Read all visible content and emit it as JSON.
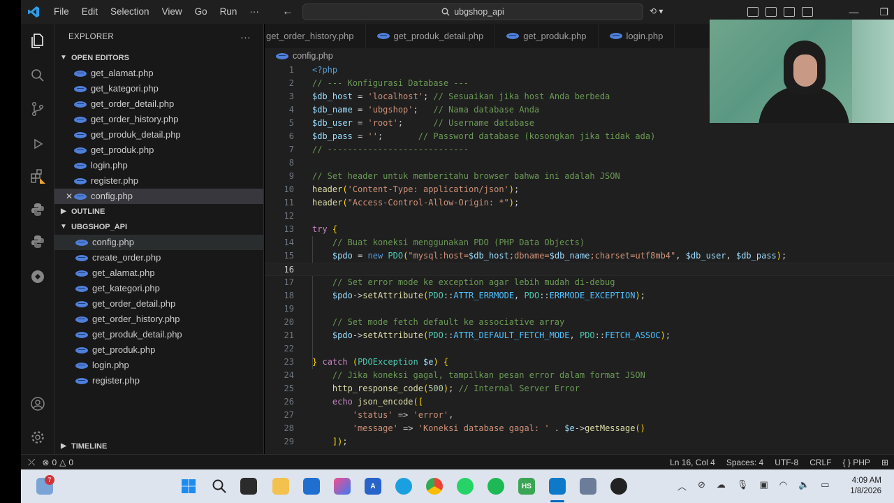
{
  "titlebar": {
    "menu": [
      "File",
      "Edit",
      "Selection",
      "View",
      "Go",
      "Run",
      "···"
    ],
    "search_text": "ubgshop_api"
  },
  "sidebar": {
    "title": "EXPLORER",
    "open_editors_label": "OPEN EDITORS",
    "open_editors": [
      "get_alamat.php",
      "get_kategori.php",
      "get_order_detail.php",
      "get_order_history.php",
      "get_produk_detail.php",
      "get_produk.php",
      "login.php",
      "register.php",
      "config.php"
    ],
    "outline_label": "OUTLINE",
    "project_label": "UBGSHOP_API",
    "project_files": [
      "config.php",
      "create_order.php",
      "get_alamat.php",
      "get_kategori.php",
      "get_order_detail.php",
      "get_order_history.php",
      "get_produk_detail.php",
      "get_produk.php",
      "login.php",
      "register.php"
    ],
    "timeline_label": "TIMELINE"
  },
  "tabs": [
    "get_order_history.php",
    "get_produk_detail.php",
    "get_produk.php",
    "login.php"
  ],
  "breadcrumb": "config.php",
  "editor": {
    "current_line": 16,
    "lines": [
      {
        "n": "1",
        "text": "<?php"
      },
      {
        "n": "2",
        "text": "// --- Konfigurasi Database ---"
      },
      {
        "n": "3",
        "text": "$db_host = 'localhost'; // Sesuaikan jika host Anda berbeda"
      },
      {
        "n": "4",
        "text": "$db_name = 'ubgshop';   // Nama database Anda"
      },
      {
        "n": "5",
        "text": "$db_user = 'root';      // Username database"
      },
      {
        "n": "6",
        "text": "$db_pass = '';       // Password database (kosongkan jika tidak ada)"
      },
      {
        "n": "7",
        "text": "// ----------------------------"
      },
      {
        "n": "8",
        "text": ""
      },
      {
        "n": "9",
        "text": "// Set header untuk memberitahu browser bahwa ini adalah JSON"
      },
      {
        "n": "10",
        "text": "header('Content-Type: application/json');"
      },
      {
        "n": "11",
        "text": "header(\"Access-Control-Allow-Origin: *\");"
      },
      {
        "n": "12",
        "text": ""
      },
      {
        "n": "13",
        "text": "try {"
      },
      {
        "n": "14",
        "text": "    // Buat koneksi menggunakan PDO (PHP Data Objects)"
      },
      {
        "n": "15",
        "text": "    $pdo = new PDO(\"mysql:host=$db_host;dbname=$db_name;charset=utf8mb4\", $db_user, $db_pass);"
      },
      {
        "n": "16",
        "text": ""
      },
      {
        "n": "17",
        "text": "    // Set error mode ke exception agar lebih mudah di-debug"
      },
      {
        "n": "18",
        "text": "    $pdo->setAttribute(PDO::ATTR_ERRMODE, PDO::ERRMODE_EXCEPTION);"
      },
      {
        "n": "19",
        "text": ""
      },
      {
        "n": "20",
        "text": "    // Set mode fetch default ke associative array"
      },
      {
        "n": "21",
        "text": "    $pdo->setAttribute(PDO::ATTR_DEFAULT_FETCH_MODE, PDO::FETCH_ASSOC);"
      },
      {
        "n": "22",
        "text": ""
      },
      {
        "n": "23",
        "text": "} catch (PDOException $e) {"
      },
      {
        "n": "24",
        "text": "    // Jika koneksi gagal, tampilkan pesan error dalam format JSON"
      },
      {
        "n": "25",
        "text": "    http_response_code(500); // Internal Server Error"
      },
      {
        "n": "26",
        "text": "    echo json_encode(["
      },
      {
        "n": "27",
        "text": "        'status' => 'error',"
      },
      {
        "n": "28",
        "text": "        'message' => 'Koneksi database gagal: ' . $e->getMessage()"
      },
      {
        "n": "29",
        "text": "    ]);"
      }
    ]
  },
  "statusbar": {
    "errors": "0",
    "warnings": "0",
    "position": "Ln 16, Col 4",
    "spaces": "Spaces: 4",
    "encoding": "UTF-8",
    "eol": "CRLF",
    "language": "PHP"
  },
  "taskbar": {
    "badge_count": "7",
    "time": "4:09 AM",
    "date": "1/8/2026"
  },
  "colors": {
    "accent": "#0078d4",
    "keyword": "#569cd6",
    "string": "#ce9178",
    "comment": "#6a9955",
    "variable": "#9cdcfe"
  }
}
